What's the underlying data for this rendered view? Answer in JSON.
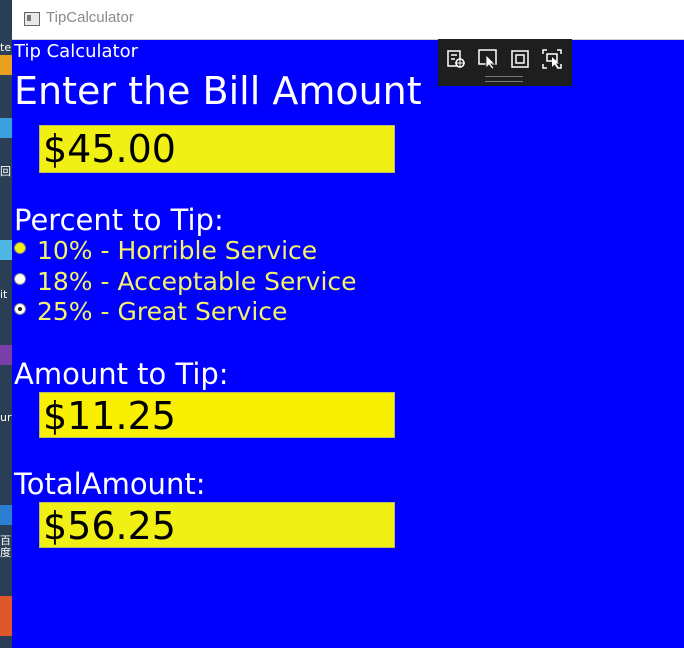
{
  "window": {
    "title": "TipCalculator"
  },
  "app": {
    "small_title": "Tip Calculator",
    "heading": "Enter the Bill Amount",
    "bill_value": "$45.00",
    "percent_label": "Percent to Tip:",
    "options": [
      {
        "label": "10% - Horrible Service",
        "selected": false
      },
      {
        "label": "18% - Acceptable Service",
        "selected": false
      },
      {
        "label": "25% - Great Service",
        "selected": true
      }
    ],
    "tip_label": "Amount to Tip:",
    "tip_value": "$11.25",
    "total_label": "TotalAmount:",
    "total_value": "$56.25"
  },
  "desktop": {
    "texts": [
      "te",
      "回",
      "it",
      "ur",
      "百度"
    ]
  },
  "colors": {
    "background": "#0000fe",
    "field": "#f0f014",
    "option_text": "#f3f26a",
    "toolbar": "#1e1e1e"
  },
  "icons": [
    "live-visual-tree-icon",
    "select-element-icon",
    "display-layout-adorners-icon",
    "track-focus-icon"
  ]
}
